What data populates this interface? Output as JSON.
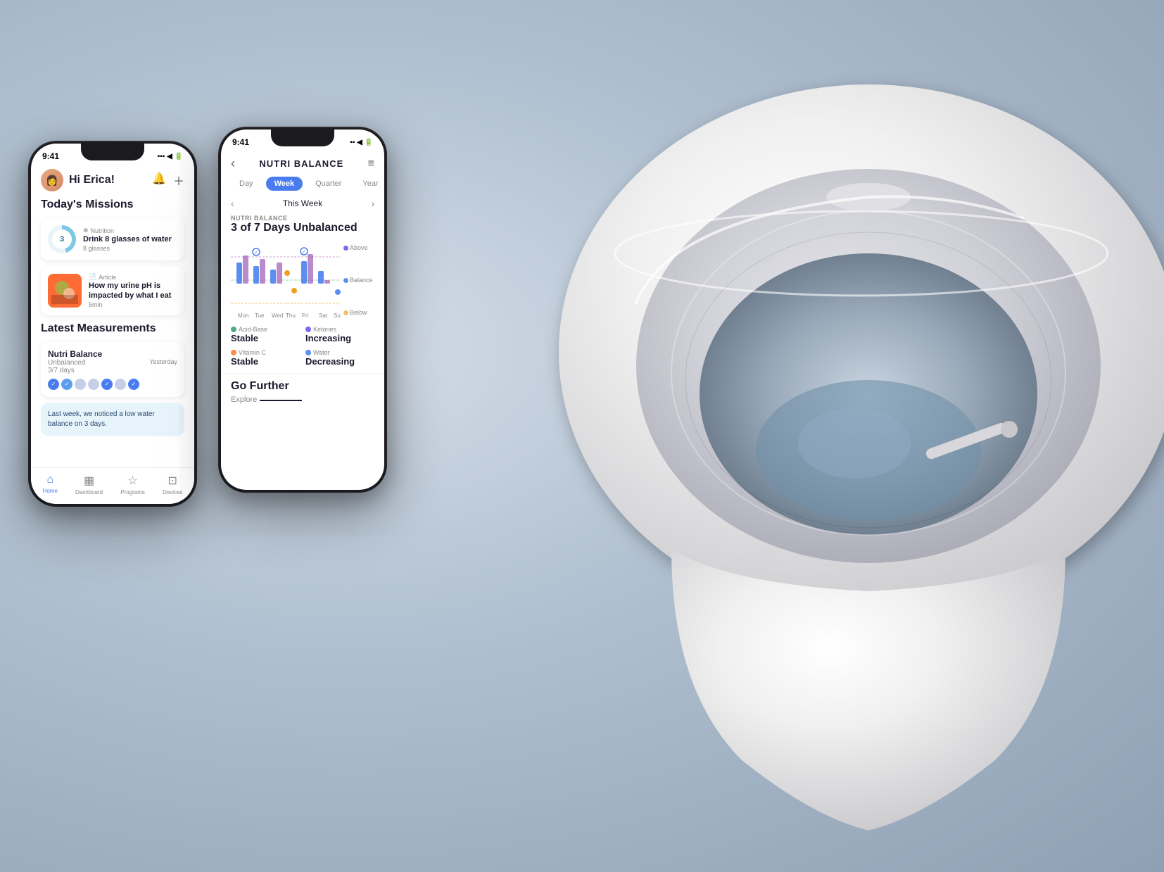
{
  "background": {
    "color_start": "#c8d4e0",
    "color_end": "#8fa0b4"
  },
  "phone1": {
    "status_time": "9:41",
    "greeting": "Hi Erica!",
    "section_missions": "Today's Missions",
    "mission1": {
      "category": "Nutrition",
      "title": "Drink 8 glasses of water",
      "sub": "8 glasses",
      "number": "3"
    },
    "mission2": {
      "category": "Article",
      "title": "How my urine pH is impacted by what I eat",
      "sub": "5min"
    },
    "section_measurements": "Latest Measurements",
    "measurement1": {
      "title": "Nutri Balance",
      "status": "Unbalanced",
      "date": "Yesterday",
      "sub": "3/7 days"
    },
    "insight": "Last week, we noticed a low water balance on 3 days.",
    "nav": {
      "home": "Home",
      "dashboard": "Dashboard",
      "programs": "Programs",
      "devices": "Devices"
    }
  },
  "phone2": {
    "status_time": "9:41",
    "title": "NUTRI BALANCE",
    "tabs": [
      "Day",
      "Week",
      "Quarter",
      "Year"
    ],
    "active_tab": "Week",
    "week_label": "This Week",
    "nutri_label": "NUTRI BALANCE",
    "nutri_value": "3 of 7 Days Unbalanced",
    "chart": {
      "days": [
        "Mon",
        "Tue",
        "Wed",
        "Thu",
        "Fri",
        "Sat",
        "Sun"
      ],
      "label_above": "Above",
      "label_balance": "Balance",
      "label_below": "Below"
    },
    "stats": {
      "acid_base_label": "Acid-Base",
      "acid_base_value": "Stable",
      "ketones_label": "Ketones",
      "ketones_value": "Increasing",
      "vitamin_c_label": "Vitamin C",
      "vitamin_c_value": "Stable",
      "water_label": "Water",
      "water_value": "Decreasing"
    },
    "go_further": "Go Further",
    "explore": "Explore"
  }
}
